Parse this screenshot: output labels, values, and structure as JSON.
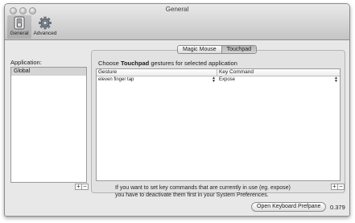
{
  "window": {
    "title": "General"
  },
  "toolbar": {
    "items": [
      {
        "label": "General",
        "icon": "switch-icon",
        "selected": true
      },
      {
        "label": "Advanced",
        "icon": "gear-icon",
        "selected": false
      }
    ]
  },
  "sidebar": {
    "label": "Application:",
    "items": [
      "Global"
    ],
    "add_label": "+",
    "remove_label": "−"
  },
  "tabs": [
    "Magic Mouse",
    "Touchpad"
  ],
  "selected_tab": "Touchpad",
  "main": {
    "choose_prefix": "Choose",
    "choose_device": "Touchpad",
    "choose_suffix": "gestures for selected application",
    "columns": [
      "Gesture",
      "Key Command"
    ],
    "rows": [
      {
        "gesture": "eleven finger tap",
        "key_command": "Expose"
      }
    ],
    "add_label": "+",
    "remove_label": "−"
  },
  "hint": {
    "line1": "If you want to set key commands that are currently in use (eg. expose)",
    "line2": "you have to deactivate them first in your System Preferences."
  },
  "footer": {
    "button_label": "Open Keyboard Prefpane",
    "version": "0.379"
  }
}
